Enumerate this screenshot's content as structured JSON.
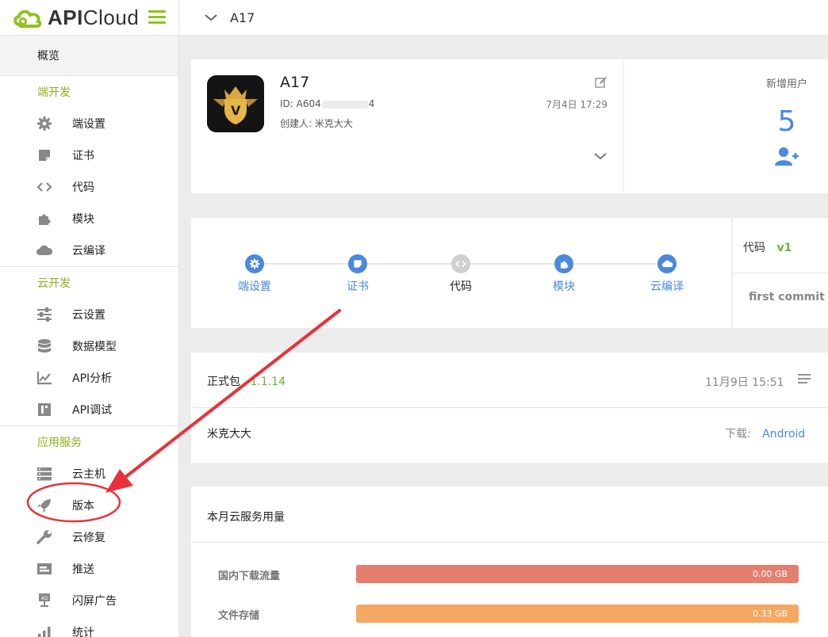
{
  "brand": {
    "name_bold": "API",
    "name_rest": "Cloud",
    "accent": "#8fc31f"
  },
  "sidebar": {
    "overview": "概览",
    "sections": [
      {
        "title": "端开发",
        "items": [
          {
            "label": "端设置",
            "icon": "gear-icon"
          },
          {
            "label": "证书",
            "icon": "certificate-icon"
          },
          {
            "label": "代码",
            "icon": "code-icon"
          },
          {
            "label": "模块",
            "icon": "puzzle-icon"
          },
          {
            "label": "云编译",
            "icon": "cloud-icon"
          }
        ]
      },
      {
        "title": "云开发",
        "items": [
          {
            "label": "云设置",
            "icon": "sliders-icon"
          },
          {
            "label": "数据模型",
            "icon": "database-icon"
          },
          {
            "label": "API分析",
            "icon": "chart-icon"
          },
          {
            "label": "API调试",
            "icon": "debug-icon"
          }
        ]
      },
      {
        "title": "应用服务",
        "items": [
          {
            "label": "云主机",
            "icon": "server-icon"
          },
          {
            "label": "版本",
            "icon": "rocket-icon"
          },
          {
            "label": "云修复",
            "icon": "wrench-icon"
          },
          {
            "label": "推送",
            "icon": "push-icon"
          },
          {
            "label": "闪屏广告",
            "icon": "ad-icon"
          },
          {
            "label": "统计",
            "icon": "stats-icon"
          }
        ]
      }
    ]
  },
  "topbar": {
    "app_name": "A17"
  },
  "app_card": {
    "name": "A17",
    "id_text": "ID: A604",
    "id_tail": "4",
    "creator": "创建人: 米克大大",
    "date": "7月4日 17:29"
  },
  "new_users": {
    "label": "新增用户",
    "count": "5"
  },
  "steps": [
    {
      "label": "端设置",
      "icon": "gear-icon",
      "current": false
    },
    {
      "label": "证书",
      "icon": "certificate-icon",
      "current": false
    },
    {
      "label": "代码",
      "icon": "code-icon",
      "current": true
    },
    {
      "label": "模块",
      "icon": "puzzle-icon",
      "current": false
    },
    {
      "label": "云编译",
      "icon": "cloud-icon",
      "current": false
    }
  ],
  "code_info": {
    "label": "代码",
    "version": "v1",
    "commit": "first commit"
  },
  "release": {
    "label": "正式包",
    "version": "1.1.14",
    "date": "11月9日 15:51",
    "creator": "米克大大",
    "download_label": "下载:",
    "download_link": "Android"
  },
  "usage": {
    "title": "本月云服务用量",
    "rows": [
      {
        "label": "国内下载流量",
        "value": "0.00 GB",
        "color": "#e47f70"
      },
      {
        "label": "文件存储",
        "value": "0.33 GB",
        "color": "#f4a862"
      }
    ]
  },
  "colors": {
    "blue": "#4a89dc",
    "green": "#8fb31a",
    "annotation_red": "#e8323a"
  }
}
